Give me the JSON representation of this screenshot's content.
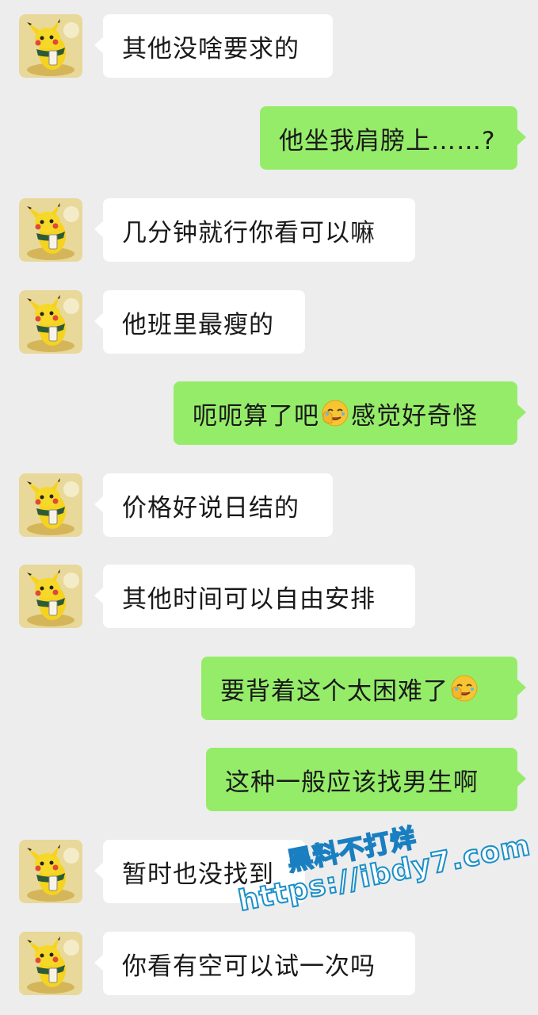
{
  "chat": {
    "messages": [
      {
        "side": "left",
        "text": "其他没啥要求的"
      },
      {
        "side": "right",
        "text": "他坐我肩膀上……?"
      },
      {
        "side": "left",
        "text": "几分钟就行你看可以嘛"
      },
      {
        "side": "left",
        "text": "他班里最瘦的"
      },
      {
        "side": "right",
        "text_before": "呃呃算了吧",
        "emoji": "facepalm-emoji",
        "text_after": "感觉好奇怪"
      },
      {
        "side": "left",
        "text": "价格好说日结的"
      },
      {
        "side": "left",
        "text": "其他时间可以自由安排"
      },
      {
        "side": "right",
        "text_before": "要背着这个太困难了",
        "emoji": "facepalm-emoji"
      },
      {
        "side": "right",
        "text": "这种一般应该找男生啊"
      },
      {
        "side": "left",
        "text": "暂时也没找到"
      },
      {
        "side": "left",
        "text": "你看有空可以试一次吗"
      }
    ],
    "avatar_icon": "pikachu-avatar-icon"
  },
  "watermark": {
    "line1": "黑料不打烊",
    "line2": "https://ibdy7.com"
  },
  "colors": {
    "background": "#ededed",
    "incoming_bubble": "#ffffff",
    "outgoing_bubble": "#95ec69",
    "text": "#191919"
  }
}
